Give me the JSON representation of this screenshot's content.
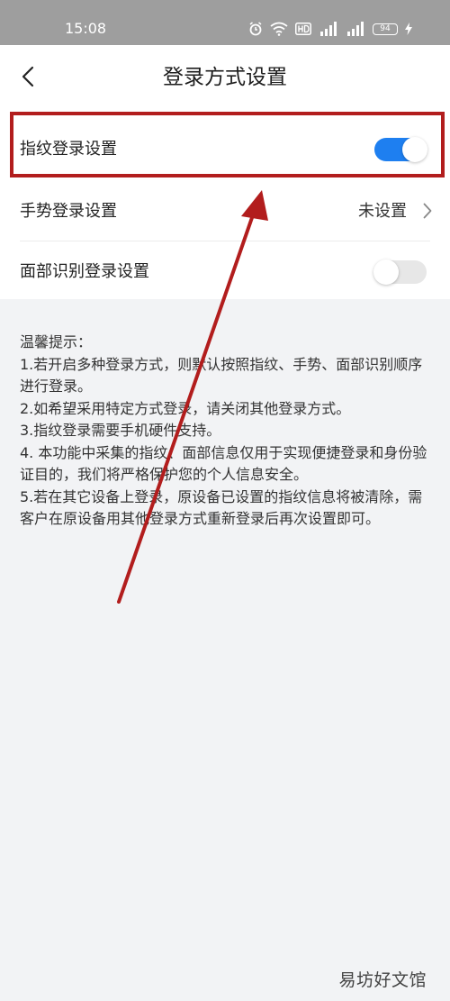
{
  "status_bar": {
    "time": "15:08",
    "battery": "94",
    "icons": [
      "alarm-icon",
      "wifi-icon",
      "hd-icon",
      "signal-icon",
      "signal-icon",
      "battery-icon",
      "charging-icon"
    ]
  },
  "header": {
    "title": "登录方式设置",
    "back_icon": "back-icon"
  },
  "settings": {
    "fingerprint": {
      "label": "指纹登录设置",
      "enabled": true
    },
    "gesture": {
      "label": "手势登录设置",
      "value": "未设置"
    },
    "face": {
      "label": "面部识别登录设置",
      "enabled": false
    }
  },
  "tips": {
    "title": "温馨提示：",
    "items": [
      "1.若开启多种登录方式，则默认按照指纹、手势、面部识别顺序进行登录。",
      "2.如希望采用特定方式登录，请关闭其他登录方式。",
      "3.指纹登录需要手机硬件支持。",
      "4. 本功能中采集的指纹、面部信息仅用于实现便捷登录和身份验证目的，我们将严格保护您的个人信息安全。",
      "5.若在其它设备上登录，原设备已设置的指纹信息将被清除，需客户在原设备用其他登录方式重新登录后再次设置即可。"
    ]
  },
  "watermark": "易坊好文馆",
  "colors": {
    "status_bar": "#9e9e9e",
    "toggle_on": "#1e7ff0",
    "toggle_off": "#e7e7e7",
    "annotation": "#b21d1d",
    "page_background": "#f2f3f5"
  }
}
